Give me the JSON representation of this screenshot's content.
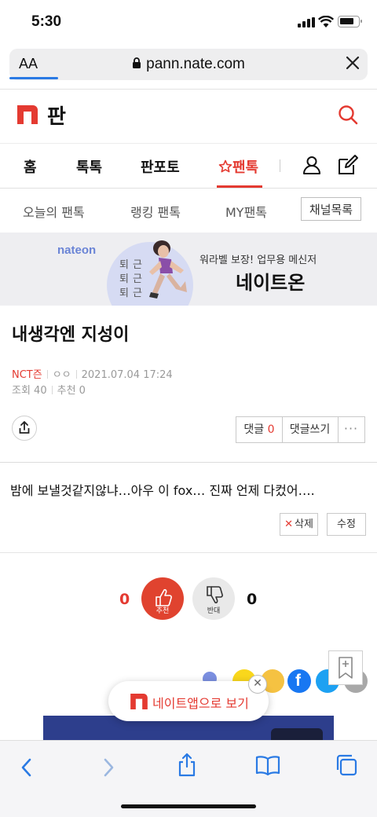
{
  "status_bar": {
    "time": "5:30"
  },
  "browser": {
    "aa_label": "AA",
    "url": "pann.nate.com"
  },
  "brand": {
    "name": "판"
  },
  "nav": {
    "items": [
      "홈",
      "톡톡",
      "판포토",
      "팬톡"
    ]
  },
  "subnav": {
    "items": [
      "오늘의 팬톡",
      "랭킹 팬톡",
      "MY팬톡"
    ],
    "channel_button": "채널목록"
  },
  "banner": {
    "logo": "nateon",
    "chars": [
      "퇴",
      "근",
      "퇴",
      "근",
      "퇴",
      "근"
    ],
    "subtitle": "워라벨 보장! 업무용 메신저",
    "title": "네이트온"
  },
  "post": {
    "title": "내생각엔 지성이",
    "channel": "NCT즌",
    "author": "ㅇㅇ",
    "datetime": "2021.07.04 17:24",
    "views": "조회 40",
    "recommends": "추천 0",
    "body": "밤에 보낼것같지않냐…아우 이 fox… 진짜 언제 다컸어….",
    "comment_label": "댓글",
    "comment_count": "0",
    "write_comment": "댓글쓰기",
    "more": "···",
    "delete_label": "삭제",
    "edit_label": "수정"
  },
  "votes": {
    "up_count": "0",
    "up_label": "추천",
    "down_count": "0",
    "down_label": "반대"
  },
  "app_popup": {
    "text": "네이트앱으로 보기"
  },
  "colors": {
    "accent": "#e43a31",
    "link": "#2a7ae4"
  },
  "icons": [
    "search-icon",
    "user-icon",
    "edit-icon",
    "share-icon",
    "close-icon",
    "thumbs-up-icon",
    "thumbs-down-icon",
    "bookmark-icon",
    "back-icon",
    "forward-icon",
    "share-sheet-icon",
    "book-icon",
    "tabs-icon"
  ]
}
